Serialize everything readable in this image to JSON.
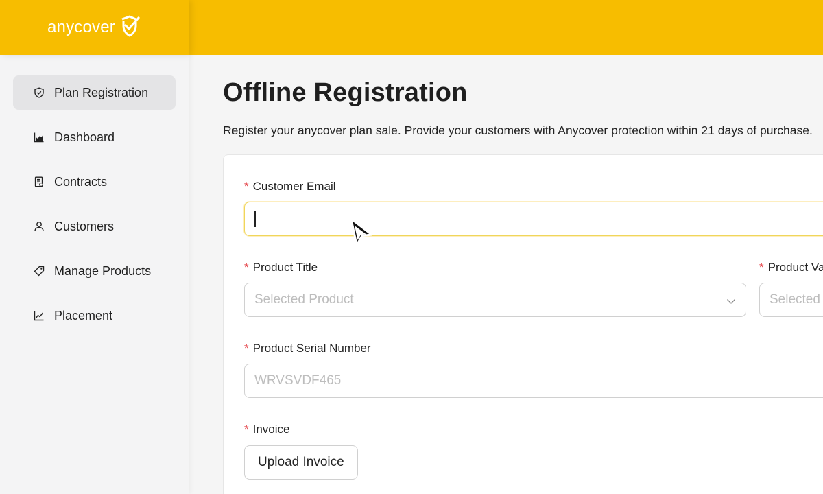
{
  "brand": {
    "name": "anycover",
    "logo_icon": "shield-check-icon"
  },
  "sidebar": {
    "items": [
      {
        "label": "Plan Registration",
        "icon": "shield-icon",
        "active": true
      },
      {
        "label": "Dashboard",
        "icon": "bar-chart-icon",
        "active": false
      },
      {
        "label": "Contracts",
        "icon": "document-icon",
        "active": false
      },
      {
        "label": "Customers",
        "icon": "user-icon",
        "active": false
      },
      {
        "label": "Manage Products",
        "icon": "tag-icon",
        "active": false
      },
      {
        "label": "Placement",
        "icon": "line-chart-icon",
        "active": false
      }
    ]
  },
  "page": {
    "title": "Offline Registration",
    "subtitle": "Register your anycover plan sale. Provide your customers with Anycover protection within 21 days of purchase."
  },
  "form": {
    "required_mark": "*",
    "email": {
      "label": "Customer Email",
      "value": ""
    },
    "product_title": {
      "label": "Product Title",
      "placeholder": "Selected Product"
    },
    "product_value": {
      "label": "Product Va",
      "placeholder": "Selected"
    },
    "serial": {
      "label": "Product Serial Number",
      "placeholder": "WRVSVDF465"
    },
    "invoice": {
      "label": "Invoice",
      "button_label": "Upload Invoice"
    }
  },
  "colors": {
    "brand_yellow": "#f7bd00",
    "required_red": "#e5484d"
  }
}
